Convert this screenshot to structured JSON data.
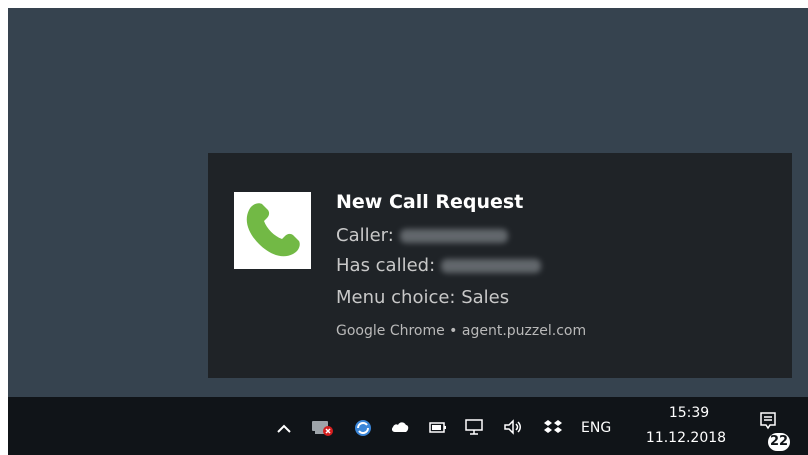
{
  "notification": {
    "title": "New Call Request",
    "caller_label": "Caller:",
    "has_called_label": "Has called:",
    "menu_choice": "Menu choice: Sales",
    "source": "Google Chrome • agent.puzzel.com",
    "icon": "phone-icon",
    "icon_color": "#72b945"
  },
  "taskbar": {
    "language": "ENG",
    "time": "15:39",
    "date": "11.12.2018",
    "notification_count": "22",
    "tray_icons": [
      "chevron-up-icon",
      "network-error-icon",
      "sync-icon",
      "cloud-icon",
      "battery-icon",
      "network-icon",
      "volume-icon",
      "dropbox-icon"
    ]
  }
}
